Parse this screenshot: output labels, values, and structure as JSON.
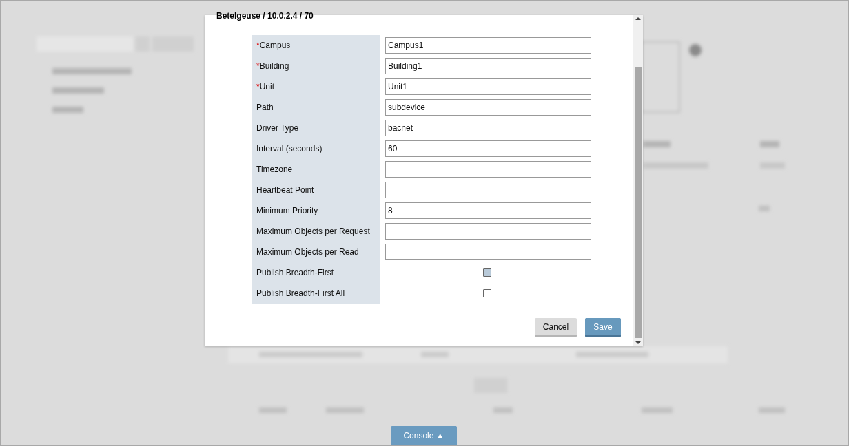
{
  "dialog": {
    "title": "Betelgeuse / 10.0.2.4 / 70",
    "fields": [
      {
        "kind": "text",
        "required_mark": "*",
        "label": "Campus",
        "value": "Campus1"
      },
      {
        "kind": "text",
        "required_mark": "*",
        "label": "Building",
        "value": "Building1"
      },
      {
        "kind": "text",
        "required_mark": "*",
        "label": "Unit",
        "value": "Unit1"
      },
      {
        "kind": "text",
        "label": "Path",
        "value": "subdevice"
      },
      {
        "kind": "text",
        "label": "Driver Type",
        "value": "bacnet"
      },
      {
        "kind": "text",
        "label": "Interval (seconds)",
        "value": "60"
      },
      {
        "kind": "text",
        "label": "Timezone"
      },
      {
        "kind": "text",
        "label": "Heartbeat Point"
      },
      {
        "kind": "text",
        "label": "Minimum Priority",
        "value": "8"
      },
      {
        "kind": "text",
        "label": "Maximum Objects per Request"
      },
      {
        "kind": "text",
        "label": "Maximum Objects per Read"
      },
      {
        "kind": "checkbox",
        "label": "Publish Breadth-First",
        "checked": false,
        "highlighted": true
      },
      {
        "kind": "checkbox",
        "label": "Publish Breadth-First All",
        "checked": false,
        "highlighted": false
      }
    ],
    "buttons": [
      {
        "kind": "cancel",
        "label": "Cancel"
      },
      {
        "kind": "primary",
        "label": "Save"
      }
    ]
  },
  "console_button": {
    "label": "Console ▲"
  }
}
